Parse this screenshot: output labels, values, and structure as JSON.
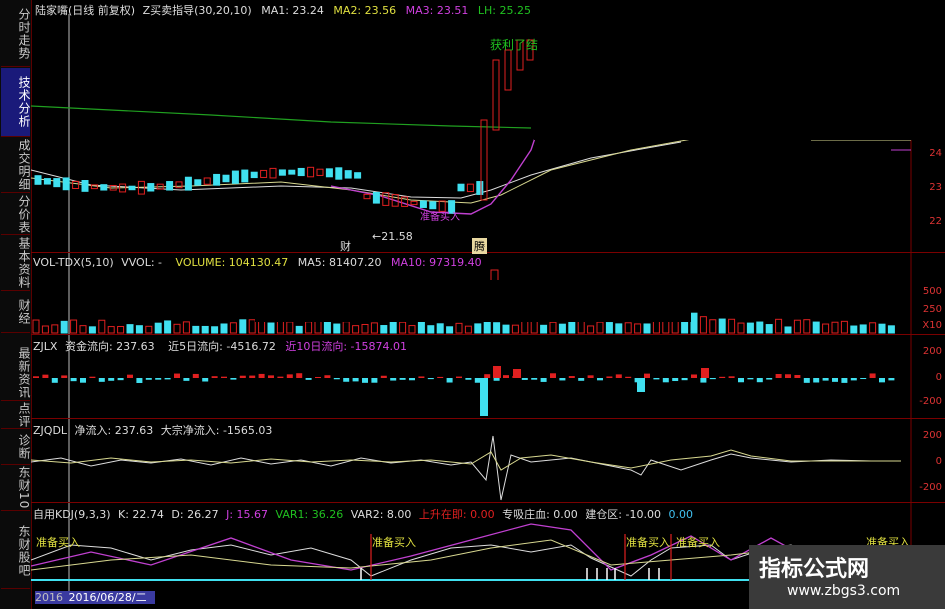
{
  "main_header": {
    "stock": "陆家嘴(日线 前复权)",
    "indicator": "Z买卖指导(30,20,10)",
    "ma1": "MA1: 23.24",
    "ma2": "MA2: 23.56",
    "ma3": "MA3: 23.51",
    "lh": "LH: 25.25"
  },
  "sidebar": {
    "tabs": [
      {
        "label": "分时走势",
        "active": false
      },
      {
        "label": "技术分析",
        "active": true
      },
      {
        "label": "成交明细",
        "active": false
      },
      {
        "label": "分价表",
        "active": false
      },
      {
        "label": "基本资料",
        "active": false
      },
      {
        "label": "财经",
        "active": false
      },
      {
        "label": "最新资讯",
        "active": false
      },
      {
        "label": "点评",
        "active": false
      },
      {
        "label": "诊断",
        "active": false
      },
      {
        "label": "东财10",
        "active": false
      },
      {
        "label": "东财股吧",
        "active": false
      }
    ]
  },
  "price_pane": {
    "annotation_profit": "获利了结",
    "low_price": "←21.58",
    "marker_cai": "财",
    "marker_teng": "腾",
    "annotation_buy": "准备买入",
    "axis": [
      "24",
      "23",
      "22"
    ]
  },
  "vol_pane": {
    "name": "VOL-TDX(5,10)",
    "vvol": "VVOL: -",
    "volume": "VOLUME: 104130.47",
    "ma5": "MA5: 81407.20",
    "ma10": "MA10: 97319.40",
    "axis": [
      "500",
      "250",
      "X10"
    ]
  },
  "zjlx_pane": {
    "name": "ZJLX",
    "flow": "资金流向: 237.63",
    "flow5": "近5日流向: -4516.72",
    "flow10": "近10日流向: -15874.01",
    "axis": [
      "200",
      "0",
      "-200"
    ]
  },
  "zjqdl_pane": {
    "name": "ZJQDL",
    "net": "净流入: 237.63",
    "big": "大宗净流入: -1565.03",
    "axis": [
      "200",
      "0",
      "-200"
    ]
  },
  "kdj_pane": {
    "name": "自用KDJ(9,3,3)",
    "k": "K: 22.74",
    "d": "D: 26.27",
    "j": "J: 15.67",
    "var1": "VAR1: 36.26",
    "var2": "VAR2: 8.00",
    "rise": "上升在即: 0.00",
    "absorb": "专吸庄血: 0.00",
    "build": "建仓区: -10.00",
    "extra": "0.00",
    "buy_labels": [
      "准备买入",
      "准备买入",
      "准备买入",
      "准备买入",
      "准备买入"
    ]
  },
  "date_bar": {
    "current": "2016/06/28/二",
    "prefix": "2016"
  },
  "watermark": {
    "title": "指标公式网",
    "url": "www.zbgs3.com"
  },
  "colors": {
    "red": "#e02020",
    "cyan": "#40e0f0",
    "magenta": "#d040e0",
    "green": "#20b020",
    "yellow": "#e0e040"
  }
}
